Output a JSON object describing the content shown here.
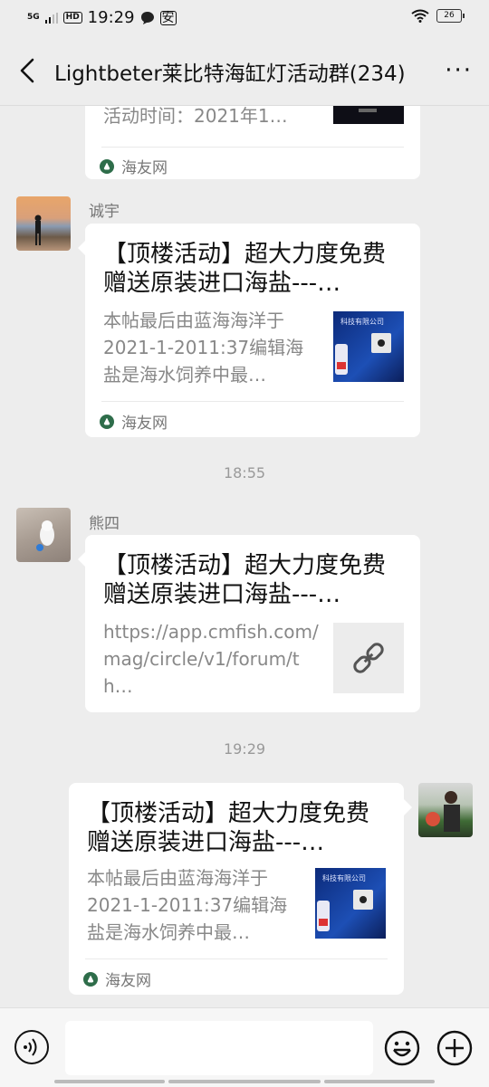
{
  "status": {
    "network": "5G",
    "hd": "HD",
    "time": "19:29",
    "msg_icon": "message-bubble-icon",
    "extra_icon": "安",
    "battery": "26"
  },
  "header": {
    "title": "Lightbeter莱比特海缸灯活动群(234)",
    "more": "···"
  },
  "messages": [
    {
      "desc": "活动时间：2021年1…",
      "source": "海友网"
    },
    {
      "sender": "诚宇",
      "title": "【顶楼活动】超大力度免费赠送原装进口海盐---…",
      "desc": "本帖最后由蓝海海洋于2021-1-2011:37编辑海盐是海水饲养中最…",
      "source": "海友网"
    },
    {
      "time": "18:55"
    },
    {
      "sender": "熊四",
      "title": "【顶楼活动】超大力度免费赠送原装进口海盐---…",
      "desc": "https://app.cmfish.com/mag/circle/v1/forum/th…"
    },
    {
      "time": "19:29"
    },
    {
      "title": "【顶楼活动】超大力度免费赠送原装进口海盐---…",
      "desc": "本帖最后由蓝海海洋于2021-1-2011:37编辑海盐是海水饲养中最…",
      "source": "海友网"
    }
  ],
  "thumb_text": "科技有限公司"
}
